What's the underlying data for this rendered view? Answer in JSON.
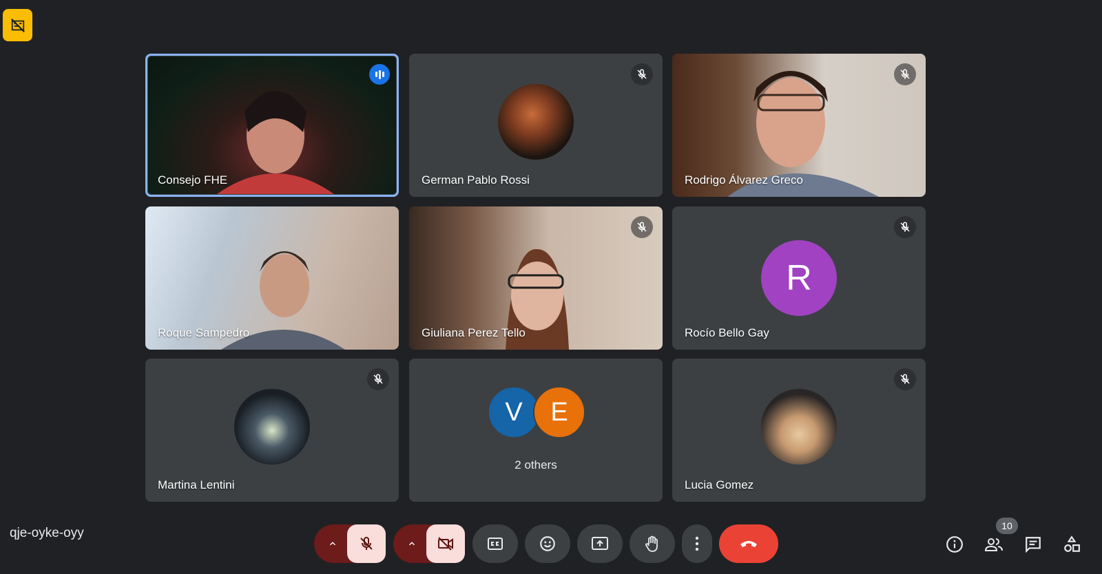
{
  "meeting": {
    "code": "qje-oyke-oyy"
  },
  "participants": [
    {
      "name": "Consejo FHE",
      "speaking": true,
      "muted": false
    },
    {
      "name": "German Pablo Rossi",
      "speaking": false,
      "muted": true
    },
    {
      "name": "Rodrigo Álvarez Greco",
      "speaking": false,
      "muted": true
    },
    {
      "name": "Roque Sampedro",
      "speaking": false,
      "muted": false
    },
    {
      "name": "Giuliana Perez Tello",
      "speaking": false,
      "muted": true
    },
    {
      "name": "Rocío Bello Gay",
      "speaking": false,
      "muted": true,
      "initial": "R",
      "color": "#a142c2"
    },
    {
      "name": "Martina Lentini",
      "speaking": false,
      "muted": true
    },
    {
      "name": "Lucia Gomez",
      "speaking": false,
      "muted": true
    }
  ],
  "others": {
    "label": "2 others",
    "initials": [
      "V",
      "E"
    ],
    "colors": [
      "#1565a8",
      "#e8710a"
    ]
  },
  "controls": {
    "participant_count": "10",
    "end_call_color": "#ea4335"
  },
  "icons": [
    "no-recording-icon",
    "mic-off-icon",
    "videocam-off-icon",
    "captions-icon",
    "emoji-icon",
    "present-icon",
    "raise-hand-icon",
    "more-vert-icon",
    "call-end-icon",
    "info-icon",
    "people-icon",
    "chat-icon",
    "activities-icon",
    "chevron-up-icon"
  ]
}
